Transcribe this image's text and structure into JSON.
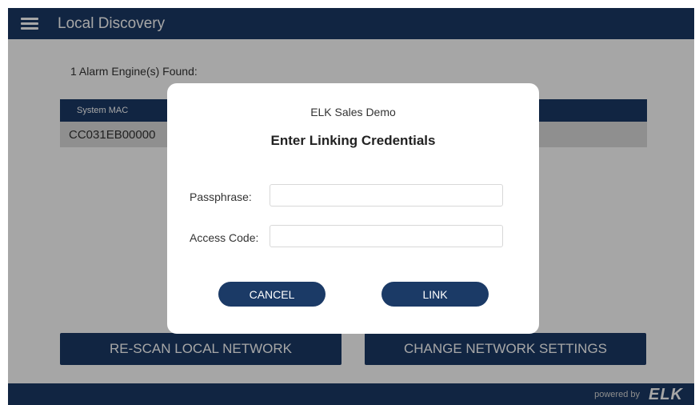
{
  "header": {
    "title": "Local Discovery",
    "menu_icon": "hamburger-menu-icon"
  },
  "discovery": {
    "found_text": "1 Alarm Engine(s) Found:",
    "table": {
      "columns": [
        "System MAC"
      ],
      "rows": [
        [
          "CC031EB00000"
        ]
      ]
    }
  },
  "actions": {
    "rescan_label": "RE-SCAN LOCAL NETWORK",
    "network_label": "CHANGE NETWORK SETTINGS"
  },
  "footer": {
    "powered_by": "powered by",
    "logo": "ELK"
  },
  "dialog": {
    "system_name": "ELK Sales Demo",
    "title": "Enter Linking Credentials",
    "passphrase_label": "Passphrase:",
    "passphrase_value": "",
    "access_code_label": "Access Code:",
    "access_code_value": "",
    "cancel_label": "CANCEL",
    "link_label": "LINK"
  },
  "colors": {
    "brand_navy": "#1b3a66",
    "row_gray": "#dcdcdc",
    "overlay": "rgba(0,0,0,0.35)"
  }
}
